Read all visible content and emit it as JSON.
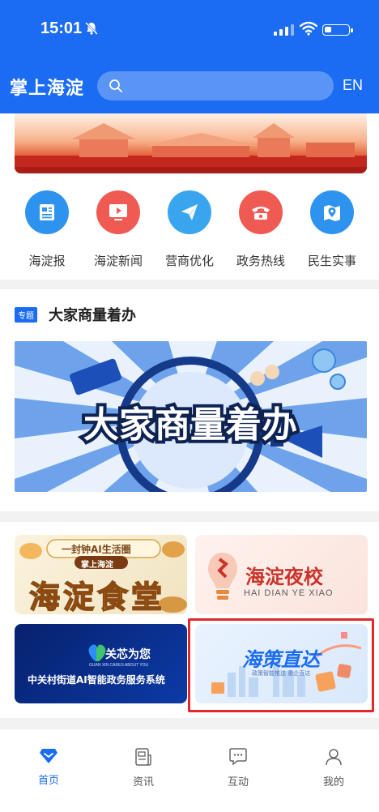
{
  "status_bar": {
    "time": "15:01"
  },
  "header": {
    "app_title": "掌上海淀",
    "search_placeholder": "",
    "lang_label": "EN"
  },
  "quick_links": [
    {
      "label": "海淀报",
      "icon": "newspaper-icon",
      "color": "#2e93ef"
    },
    {
      "label": "海淀新闻",
      "icon": "tv-play-icon",
      "color": "#ef5b52"
    },
    {
      "label": "营商优化",
      "icon": "paper-plane-icon",
      "color": "#3aa5ef"
    },
    {
      "label": "政务热线",
      "icon": "telephone-icon",
      "color": "#ef5b52"
    },
    {
      "label": "民生实事",
      "icon": "map-pin-icon",
      "color": "#2e93ef"
    }
  ],
  "topic": {
    "tag": "专题",
    "title": "大家商量着办",
    "banner_text": "大家商量着办"
  },
  "tiles": {
    "canteen": {
      "top_line": "一封钟AI生活圈",
      "badge": "掌上海淀",
      "title": "海淀食堂"
    },
    "night_school": {
      "title": "海淀夜校",
      "subtitle": "HAI DIAN YE XIAO"
    },
    "zhongguancun": {
      "title": "关芯为您",
      "subtitle": "GUAN XIN CARES ABOUT YOU",
      "desc": "中关村街道AI智能政务服务系统"
    },
    "policy": {
      "title": "海策直达",
      "subtitle": "政策智能推送 惠企直达"
    }
  },
  "bottom_nav": [
    {
      "label": "首页",
      "icon": "home-diamond-icon",
      "active": true
    },
    {
      "label": "资讯",
      "icon": "news-doc-icon",
      "active": false
    },
    {
      "label": "互动",
      "icon": "chat-bubble-icon",
      "active": false
    },
    {
      "label": "我的",
      "icon": "user-icon",
      "active": false
    }
  ],
  "colors": {
    "brand": "#1b6cf2",
    "highlight": "#e2282b"
  }
}
